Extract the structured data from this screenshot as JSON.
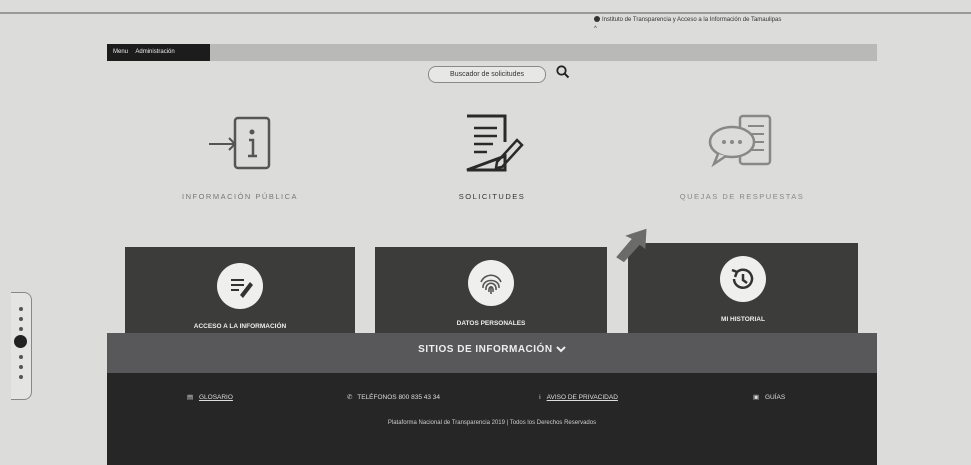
{
  "header": {
    "institution": "Instituto de Transparencia y Acceso a la Información de Tamaulipas",
    "institution_caret": "^"
  },
  "navbar": {
    "items": [
      "Menu",
      "Administración"
    ]
  },
  "search": {
    "label": "Buscador de solicitudes"
  },
  "categories": [
    {
      "label": "INFORMACIÓN PÚBLICA",
      "icon": "info-icon"
    },
    {
      "label": "SOLICITUDES",
      "icon": "document-pen-icon"
    },
    {
      "label": "QUEJAS DE RESPUESTAS",
      "icon": "chat-document-icon"
    }
  ],
  "cards": [
    {
      "label": "ACCESO A LA INFORMACIÓN",
      "icon": "document-edit-icon"
    },
    {
      "label": "DATOS PERSONALES",
      "icon": "fingerprint-icon"
    },
    {
      "label": "MI HISTORIAL",
      "icon": "history-icon"
    }
  ],
  "sitios": {
    "title": "SITIOS DE INFORMACIÓN"
  },
  "footer": {
    "links": [
      "GLOSARIO",
      "TELÉFONOS 800 835 43 34",
      "AVISO DE PRIVACIDAD",
      "GUÍAS"
    ],
    "copyright": "Plataforma Nacional de Transparencia 2019 | Todos los Derechos Reservados"
  },
  "colors": {
    "background": "#dcdcda",
    "card": "#3c3c3a",
    "footer": "#262626",
    "sitios_bar": "#58585a"
  }
}
